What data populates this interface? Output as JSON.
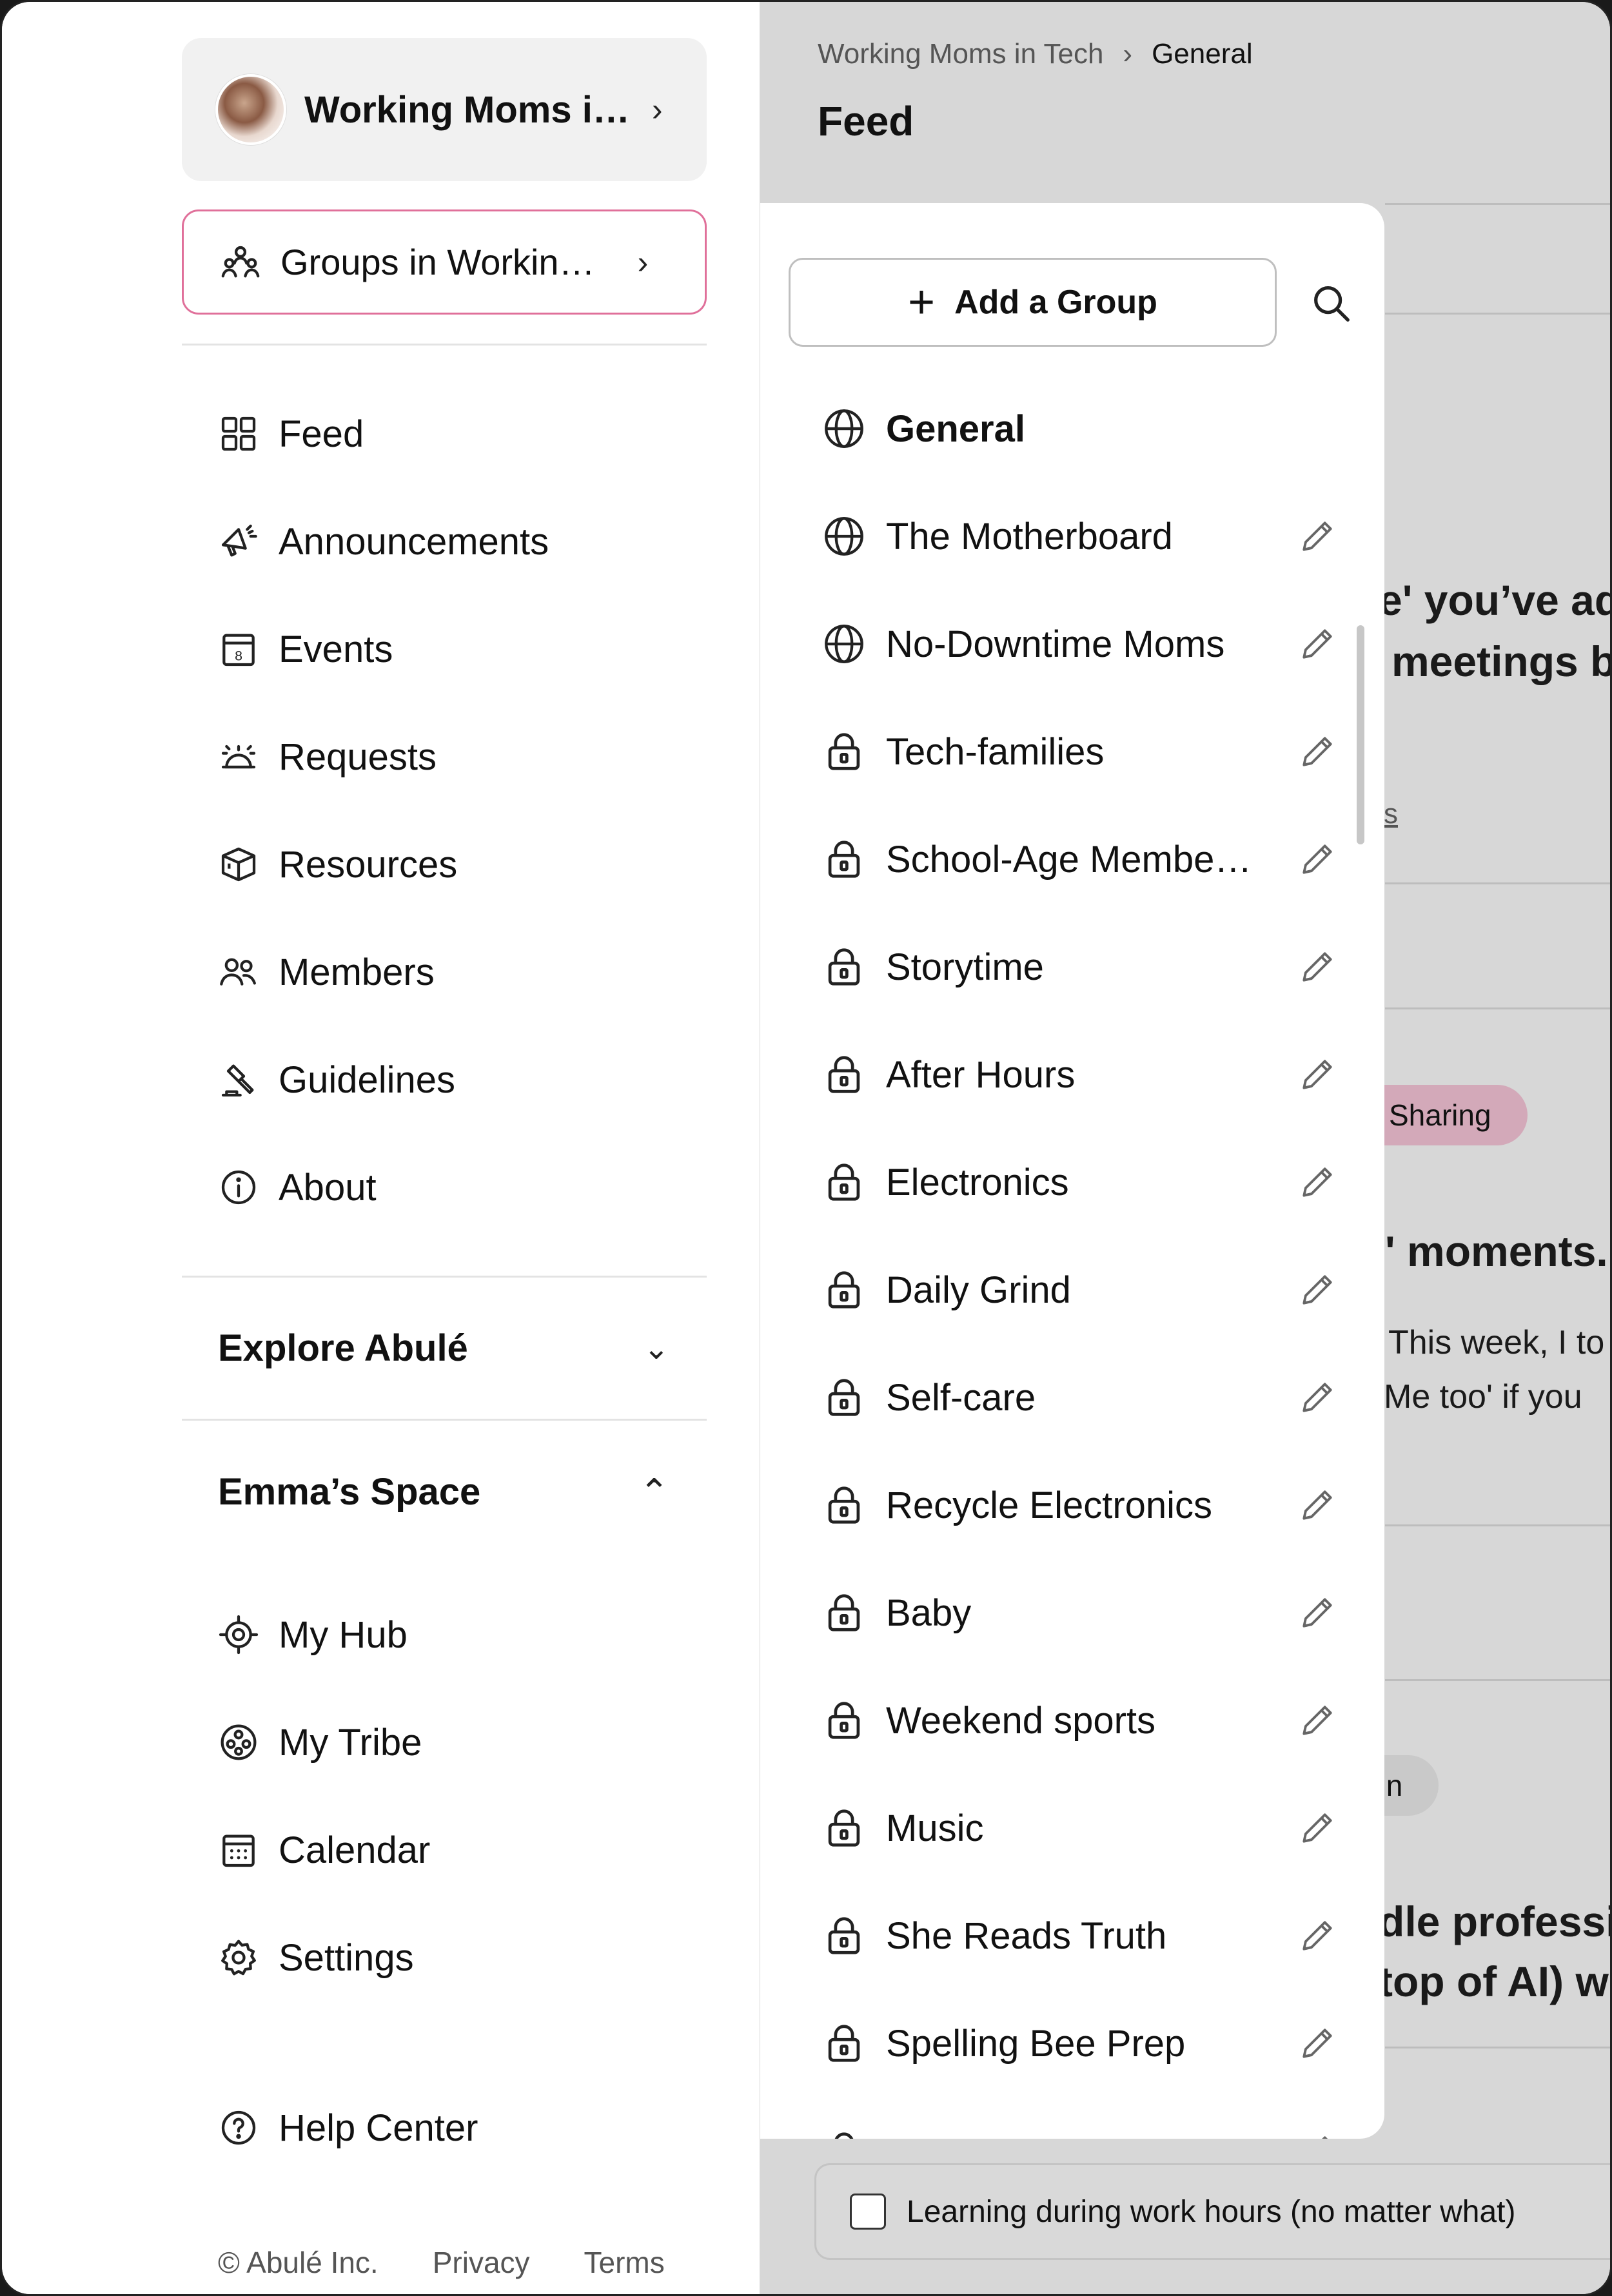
{
  "community": {
    "name": "Working Moms i…"
  },
  "groups_button": {
    "label": "Groups in Workin…"
  },
  "nav": [
    {
      "key": "feed",
      "label": "Feed",
      "icon": "grid-icon"
    },
    {
      "key": "announcements",
      "label": "Announcements",
      "icon": "megaphone-icon"
    },
    {
      "key": "events",
      "label": "Events",
      "icon": "calendar-day-icon"
    },
    {
      "key": "requests",
      "label": "Requests",
      "icon": "alarm-bell-icon"
    },
    {
      "key": "resources",
      "label": "Resources",
      "icon": "box-icon"
    },
    {
      "key": "members",
      "label": "Members",
      "icon": "members-icon"
    },
    {
      "key": "guidelines",
      "label": "Guidelines",
      "icon": "gavel-icon"
    },
    {
      "key": "about",
      "label": "About",
      "icon": "info-icon"
    }
  ],
  "explore": {
    "title": "Explore Abulé"
  },
  "space": {
    "title": "Emma’s Space",
    "items": [
      {
        "key": "my-hub",
        "label": "My Hub",
        "icon": "crosshair-icon"
      },
      {
        "key": "my-tribe",
        "label": "My Tribe",
        "icon": "tribe-icon"
      },
      {
        "key": "calendar",
        "label": "Calendar",
        "icon": "calendar-icon"
      },
      {
        "key": "settings",
        "label": "Settings",
        "icon": "gear-icon"
      }
    ]
  },
  "help": {
    "label": "Help Center"
  },
  "footer": {
    "copyright": "© Abulé Inc.",
    "privacy": "Privacy",
    "terms": "Terms"
  },
  "breadcrumb": {
    "parent": "Working Moms in Tech",
    "current": "General"
  },
  "page_title": "Feed",
  "groups_panel": {
    "add_label": "Add a Group",
    "groups": [
      {
        "name": "General",
        "type": "public",
        "selected": true,
        "editable": false
      },
      {
        "name": "The Motherboard",
        "type": "public",
        "editable": true
      },
      {
        "name": "No-Downtime Moms",
        "type": "public",
        "editable": true
      },
      {
        "name": "Tech-families",
        "type": "private",
        "editable": true
      },
      {
        "name": "School-Age Membe…",
        "type": "private",
        "editable": true
      },
      {
        "name": "Storytime",
        "type": "private",
        "editable": true
      },
      {
        "name": "After Hours",
        "type": "private",
        "editable": true
      },
      {
        "name": "Electronics",
        "type": "private",
        "editable": true
      },
      {
        "name": "Daily Grind",
        "type": "private",
        "editable": true
      },
      {
        "name": "Self-care",
        "type": "private",
        "editable": true
      },
      {
        "name": "Recycle Electronics",
        "type": "private",
        "editable": true
      },
      {
        "name": "Baby",
        "type": "private",
        "editable": true
      },
      {
        "name": "Weekend sports",
        "type": "private",
        "editable": true
      },
      {
        "name": "Music",
        "type": "private",
        "editable": true
      },
      {
        "name": "She Reads Truth",
        "type": "private",
        "editable": true
      },
      {
        "name": "Spelling Bee Prep",
        "type": "private",
        "editable": true
      }
    ]
  },
  "background_feed": {
    "fragment1": "e' you’ve ad",
    "fragment2": "meetings b",
    "fragment3": "s",
    "tag1": "Sharing",
    "fragment4": "' moments.",
    "fragment5": "This week, I to",
    "fragment6": "Me too' if you",
    "tag2": "ain",
    "fragment7": "dle professio",
    "fragment8": "top of AI) wh",
    "checkbox_label": "Learning during work hours (no matter what)"
  }
}
